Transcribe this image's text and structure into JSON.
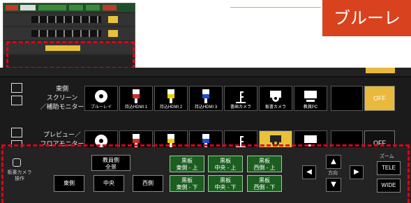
{
  "banner": {
    "text": "ブルーレ"
  },
  "rows": [
    {
      "label": "東側\nスクリーン\n／補助モニター",
      "off": "OFF"
    },
    {
      "label": "プレビュー／\nフロアモニター",
      "off": "OFF"
    }
  ],
  "sources": [
    "ブルーレイ",
    "持込HDMI 1",
    "持込HDMI 2",
    "持込HDMI 3",
    "書画カメラ",
    "板書カメラ",
    "教員PC"
  ],
  "camera": {
    "label": "板書カメラ\n操作",
    "teacher_full": "教員側\n全景",
    "east": "東側",
    "center": "中央",
    "west": "西側",
    "presets_top": [
      "黒板\n東側 - 上",
      "黒板\n中央 - 上",
      "黒板\n西側 - 上"
    ],
    "presets_bottom": [
      "黒板\n東側 - 下",
      "黒板\n中央 - 下",
      "黒板\n西側 - 下"
    ],
    "direction": "方向",
    "zoom": "ズーム",
    "tele": "TELE",
    "wide": "WIDE"
  },
  "colors": {
    "accent": "#e8c23a",
    "preset_green": "#1b5e20",
    "highlight": "#e0001a"
  }
}
